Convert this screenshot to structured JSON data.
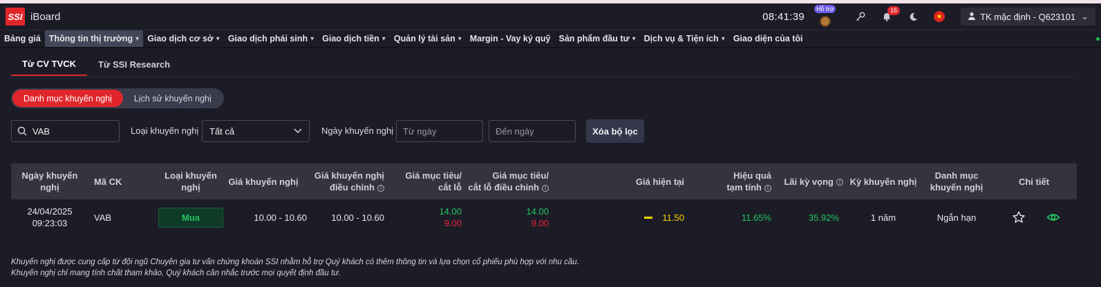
{
  "app": {
    "logo_text": "SSI",
    "name": "iBoard"
  },
  "header": {
    "clock": "08:41:39",
    "support_label": "Hỗ trợ",
    "notifications_count": "16",
    "account_label": "TK mặc định - Q623101",
    "flag_icon": "vietnam-flag-icon"
  },
  "menu": {
    "items": [
      {
        "label": "Bảng giá",
        "has_dropdown": false
      },
      {
        "label": "Thông tin thị trường",
        "has_dropdown": true,
        "active": true
      },
      {
        "label": "Giao dịch cơ sở",
        "has_dropdown": true
      },
      {
        "label": "Giao dịch phái sinh",
        "has_dropdown": true
      },
      {
        "label": "Giao dịch tiền",
        "has_dropdown": true
      },
      {
        "label": "Quản lý tài sản",
        "has_dropdown": true
      },
      {
        "label": "Margin - Vay ký quỹ",
        "has_dropdown": false
      },
      {
        "label": "Sản phẩm đầu tư",
        "has_dropdown": true
      },
      {
        "label": "Dịch vụ & Tiện ích",
        "has_dropdown": true
      },
      {
        "label": "Giao diện của tôi",
        "has_dropdown": false
      }
    ]
  },
  "tabs": [
    {
      "label": "Từ CV TVCK",
      "active": true
    },
    {
      "label": "Từ SSI Research",
      "active": false
    }
  ],
  "segment": {
    "options": [
      {
        "label": "Danh mục khuyến nghị",
        "active": true
      },
      {
        "label": "Lịch sử khuyến nghị",
        "active": false
      }
    ]
  },
  "filters": {
    "search_value": "VAB",
    "type_label": "Loại khuyến nghị",
    "type_value": "Tất cả",
    "date_label": "Ngày khuyến nghị",
    "from_placeholder": "Từ ngày",
    "to_placeholder": "Đến ngày",
    "clear_label": "Xóa bộ lọc"
  },
  "table": {
    "headers": {
      "date": [
        "Ngày khuyến",
        "nghị"
      ],
      "symbol": "Mã CK",
      "type": [
        "Loại khuyến",
        "nghị"
      ],
      "rec_price": "Giá khuyến nghị",
      "rec_price_adj": [
        "Giá khuyến nghị",
        "điều chỉnh"
      ],
      "target": [
        "Giá mục tiêu/",
        "cắt lỗ"
      ],
      "target_adj": [
        "Giá mục tiêu/",
        "cắt lỗ điều chỉnh"
      ],
      "current": "Giá hiện tại",
      "perf": [
        "Hiệu quả",
        "tạm tính"
      ],
      "expected": "Lãi kỳ vọng",
      "term": "Kỳ khuyến nghị",
      "category": [
        "Danh mục",
        "khuyến nghị"
      ],
      "detail": "Chi tiết"
    },
    "rows": [
      {
        "date": "24/04/2025",
        "time": "09:23:03",
        "symbol": "VAB",
        "type": "Mua",
        "rec_price": "10.00 - 10.60",
        "rec_price_adj": "10.00 - 10.60",
        "target": "14.00",
        "stoploss": "9.00",
        "target_adj": "14.00",
        "stoploss_adj": "9.00",
        "current": "11.50",
        "perf": "11.65%",
        "expected": "35.92%",
        "term": "1 năm",
        "category": "Ngắn hạn"
      }
    ]
  },
  "notes": [
    "Khuyến nghị được cung cấp từ đội ngũ Chuyên gia tư vấn chứng khoán SSI nhằm hỗ trợ Quý khách có thêm thông tin và lựa chọn cổ phiếu phù hợp với nhu cầu.",
    "Khuyến nghị chỉ mang tính chất tham khảo, Quý khách cân nhắc trước mọi quyết định đầu tư."
  ],
  "colors": {
    "background": "#1c1c27",
    "accent": "#e0262b",
    "up": "#22c55e",
    "down": "#ef233c",
    "ref": "#ffd400"
  }
}
